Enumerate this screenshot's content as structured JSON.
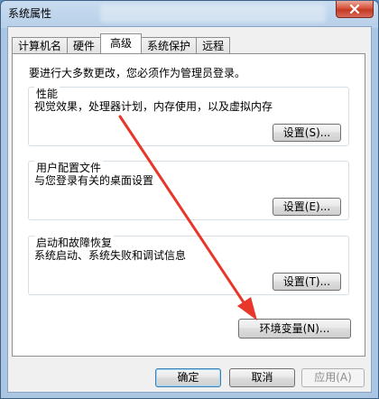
{
  "window": {
    "title": "系统属性",
    "close_icon": "close-icon",
    "accent": "#abc6e2",
    "close_color": "#c33a22"
  },
  "tabs": [
    {
      "label": "计算机名"
    },
    {
      "label": "硬件"
    },
    {
      "label": "高级",
      "active": true
    },
    {
      "label": "系统保护"
    },
    {
      "label": "远程"
    }
  ],
  "panel": {
    "note": "要进行大多数更改，您必须作为管理员登录。",
    "performance": {
      "title": "性能",
      "desc": "视觉效果，处理器计划，内存使用，以及虚拟内存",
      "button": "设置(S)..."
    },
    "profile": {
      "title": "用户配置文件",
      "desc": "与您登录有关的桌面设置",
      "button": "设置(E)..."
    },
    "startup": {
      "title": "启动和故障恢复",
      "desc": "系统启动、系统失败和调试信息",
      "button": "设置(T)..."
    },
    "env_button": "环境变量(N)..."
  },
  "footer": {
    "ok": "确定",
    "cancel": "取消",
    "apply": "应用(A)"
  },
  "annotation": {
    "arrow_color": "#e8372a"
  }
}
